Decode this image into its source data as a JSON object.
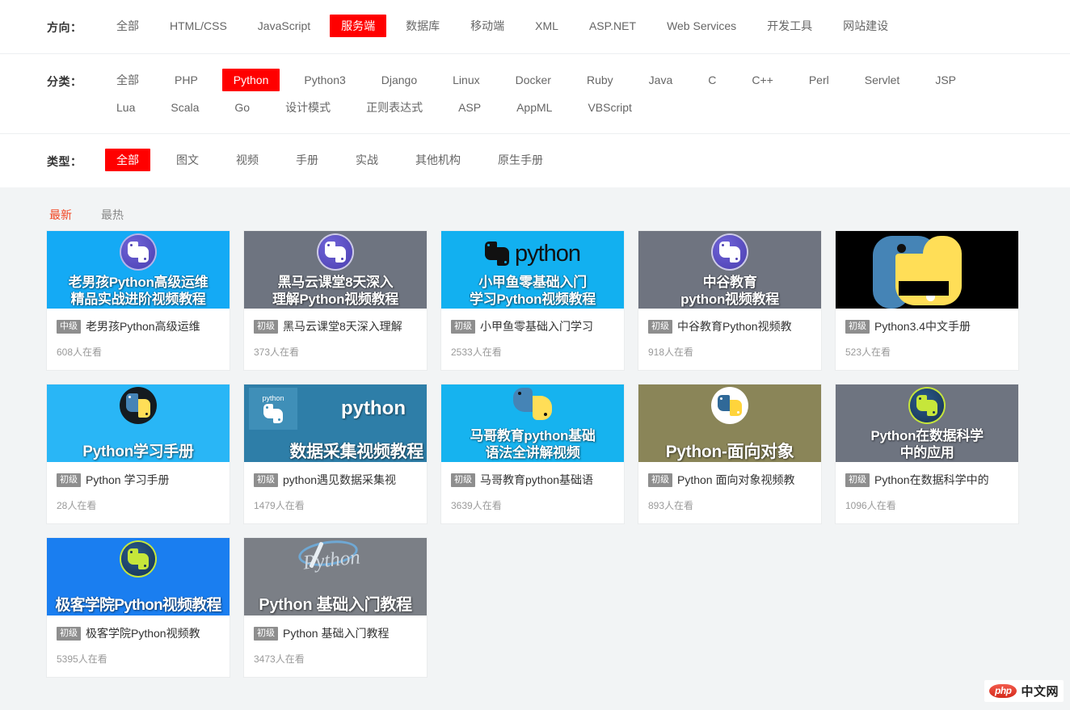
{
  "filters": [
    {
      "label": "方向：",
      "name": "direction",
      "items": [
        {
          "label": "全部",
          "active": false
        },
        {
          "label": "HTML/CSS",
          "active": false
        },
        {
          "label": "JavaScript",
          "active": false
        },
        {
          "label": "服务端",
          "active": true
        },
        {
          "label": "数据库",
          "active": false
        },
        {
          "label": "移动端",
          "active": false
        },
        {
          "label": "XML",
          "active": false
        },
        {
          "label": "ASP.NET",
          "active": false
        },
        {
          "label": "Web Services",
          "active": false
        },
        {
          "label": "开发工具",
          "active": false
        },
        {
          "label": "网站建设",
          "active": false
        }
      ]
    },
    {
      "label": "分类：",
      "name": "category",
      "items": [
        {
          "label": "全部",
          "active": false
        },
        {
          "label": "PHP",
          "active": false
        },
        {
          "label": "Python",
          "active": true
        },
        {
          "label": "Python3",
          "active": false
        },
        {
          "label": "Django",
          "active": false
        },
        {
          "label": "Linux",
          "active": false
        },
        {
          "label": "Docker",
          "active": false
        },
        {
          "label": "Ruby",
          "active": false
        },
        {
          "label": "Java",
          "active": false
        },
        {
          "label": "C",
          "active": false
        },
        {
          "label": "C++",
          "active": false
        },
        {
          "label": "Perl",
          "active": false
        },
        {
          "label": "Servlet",
          "active": false
        },
        {
          "label": "JSP",
          "active": false
        },
        {
          "label": "Lua",
          "active": false
        },
        {
          "label": "Scala",
          "active": false
        },
        {
          "label": "Go",
          "active": false
        },
        {
          "label": "设计模式",
          "active": false
        },
        {
          "label": "正则表达式",
          "active": false
        },
        {
          "label": "ASP",
          "active": false
        },
        {
          "label": "AppML",
          "active": false
        },
        {
          "label": "VBScript",
          "active": false
        }
      ]
    },
    {
      "label": "类型：",
      "name": "type",
      "items": [
        {
          "label": "全部",
          "active": true
        },
        {
          "label": "图文",
          "active": false
        },
        {
          "label": "视频",
          "active": false
        },
        {
          "label": "手册",
          "active": false
        },
        {
          "label": "实战",
          "active": false
        },
        {
          "label": "其他机构",
          "active": false
        },
        {
          "label": "原生手册",
          "active": false
        }
      ]
    }
  ],
  "sort": {
    "items": [
      {
        "label": "最新",
        "active": true
      },
      {
        "label": "最热",
        "active": false
      }
    ]
  },
  "colors": {
    "accent": "#ff0000",
    "active_sort": "#f24724",
    "badge": "#8e8e8e",
    "page_bg": "#f2f4f5"
  },
  "cards": [
    {
      "thumb_title_1": "老男孩Python高级运维",
      "thumb_title_2": "精品实战进阶视频教程",
      "badge": "中级",
      "title": "老男孩Python高级运维",
      "viewers": "608人在看",
      "thumb_bg": "#14aaf5",
      "logo": "python-coin-purple-icon"
    },
    {
      "thumb_title_1": "黑马云课堂8天深入",
      "thumb_title_2": "理解Python视频教程",
      "badge": "初级",
      "title": "黑马云课堂8天深入理解",
      "viewers": "373人在看",
      "thumb_bg": "#6e7480",
      "logo": "python-coin-purple-icon"
    },
    {
      "thumb_title_1": "小甲鱼零基础入门",
      "thumb_title_2": "学习Python视频教程",
      "badge": "初级",
      "title": "小甲鱼零基础入门学习",
      "viewers": "2533人在看",
      "thumb_bg": "#12b0f0",
      "logo": "python-wordmark-black-icon"
    },
    {
      "thumb_title_1": "中谷教育",
      "thumb_title_2": "python视频教程",
      "badge": "初级",
      "title": "中谷教育Python视频教",
      "viewers": "918人在看",
      "thumb_bg": "#6f7480",
      "logo": "python-coin-purple-icon"
    },
    {
      "thumb_title_1": "",
      "thumb_title_2": "",
      "badge": "初级",
      "title": "Python3.4中文手册",
      "viewers": "523人在看",
      "thumb_bg": "#000000",
      "logo": "python-snake-big-icon"
    },
    {
      "thumb_title_1": "",
      "thumb_title_2": "Python学习手册",
      "badge": "初级",
      "title": "Python 学习手册",
      "viewers": "28人在看",
      "thumb_bg": "#29b6f6",
      "logo": "python-coin-dark-icon"
    },
    {
      "thumb_title_1": "python",
      "thumb_title_2": "数据采集视频教程",
      "badge": "初级",
      "title": "python遇见数据采集视",
      "viewers": "1479人在看",
      "thumb_bg": "#2e7ea8",
      "logo": "python-tile-icon"
    },
    {
      "thumb_title_1": "马哥教育python基础",
      "thumb_title_2": "语法全讲解视频",
      "badge": "初级",
      "title": "马哥教育python基础语",
      "viewers": "3639人在看",
      "thumb_bg": "#16b3ef",
      "logo": "python-snake-flat-icon"
    },
    {
      "thumb_title_1": "",
      "thumb_title_2": "Python-面向对象",
      "badge": "初级",
      "title": "Python 面向对象视频教",
      "viewers": "893人在看",
      "thumb_bg": "#8a8558",
      "logo": "python-coin-white-icon"
    },
    {
      "thumb_title_1": "Python在数据科学",
      "thumb_title_2": "中的应用",
      "badge": "初级",
      "title": "Python在数据科学中的",
      "viewers": "1096人在看",
      "thumb_bg": "#6e7480",
      "logo": "python-coin-green-icon"
    },
    {
      "thumb_title_1": "",
      "thumb_title_2": "极客学院Python视频教程",
      "badge": "初级",
      "title": "极客学院Python视频教",
      "viewers": "5395人在看",
      "thumb_bg": "#1a7ef0",
      "logo": "python-coin-green-icon"
    },
    {
      "thumb_title_1": "",
      "thumb_title_2": "Python 基础入门教程",
      "badge": "初级",
      "title": "Python 基础入门教程",
      "viewers": "3473人在看",
      "thumb_bg": "#7b7f86",
      "logo": "python-script-icon"
    }
  ],
  "watermark": {
    "logo_text": "php",
    "text": "中文网"
  }
}
